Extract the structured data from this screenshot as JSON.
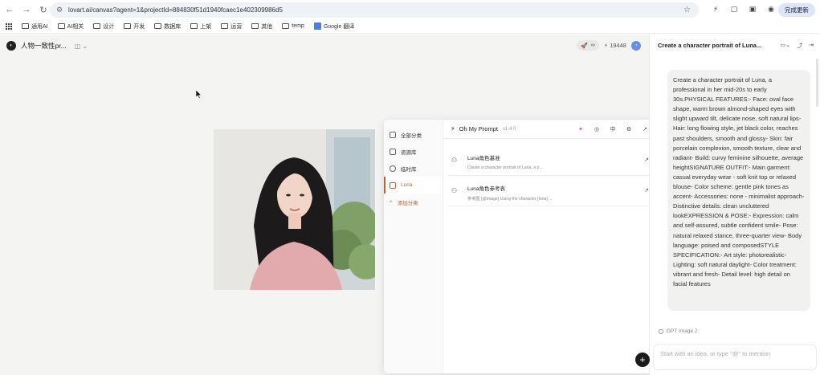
{
  "browser": {
    "url": "lovart.ai/canvas?agent=1&projectId=884830f51d1940fcaec1e402309986d5",
    "update_label": "完成更新",
    "bookmarks": [
      "通用AI",
      "AI相关",
      "设计",
      "开发",
      "数据库",
      "上架",
      "运营",
      "其他",
      "temp",
      "Google 翻译"
    ]
  },
  "app": {
    "title": "人物一致性pr...",
    "credits": "19448",
    "pill_label": "∞"
  },
  "popover": {
    "sidebar": [
      {
        "label": "全部分类",
        "icon": "folder-icon"
      },
      {
        "label": "资源库",
        "icon": "library-icon"
      },
      {
        "label": "临时库",
        "icon": "clock-icon"
      },
      {
        "label": "Luna",
        "icon": "box-icon",
        "active": true
      },
      {
        "label": "添加分类",
        "icon": "plus-icon"
      }
    ],
    "header": {
      "title": "Oh My Prompt",
      "version": "v1.4.0"
    },
    "items": [
      {
        "title": "Luna角色基准",
        "desc": "Create a character portrait of Luna, a p..."
      },
      {
        "title": "Luna角色参考表",
        "desc": "参考图 [@image] Using the character [luna] ..."
      }
    ]
  },
  "chat": {
    "header_title": "Create a character portrait of Luna...",
    "message": "Create a character portrait of Luna, a professional in her mid-20s to early 30s.PHYSICAL FEATURES:- Face: oval face shape, warm brown almond-shaped eyes with slight upward tilt, delicate nose, soft natural lips- Hair: long flowing style, jet black color, reaches past shoulders, smooth and glossy- Skin: fair porcelain complexion, smooth texture, clear and radiant- Build: curvy feminine silhouette, average heightSIGNATURE OUTFIT:- Main garment: casual everyday wear - soft knit top or relaxed blouse- Color scheme: gentle pink tones as accent- Accessories: none - minimalist approach- Distinctive details: clean uncluttered lookEXPRESSION & POSE:- Expression: calm and self-assured, subtle confident smile- Pose: natural relaxed stance, three-quarter view- Body language: poised and composedSTYLE SPECIFICATION:- Art style: photorealistic- Lighting: soft natural daylight- Color treatment: vibrant and fresh- Detail level: high detail on facial features",
    "model_label": "GPT Image 2",
    "input_placeholder": "Start with an idea, or type \"@\" to mention"
  }
}
